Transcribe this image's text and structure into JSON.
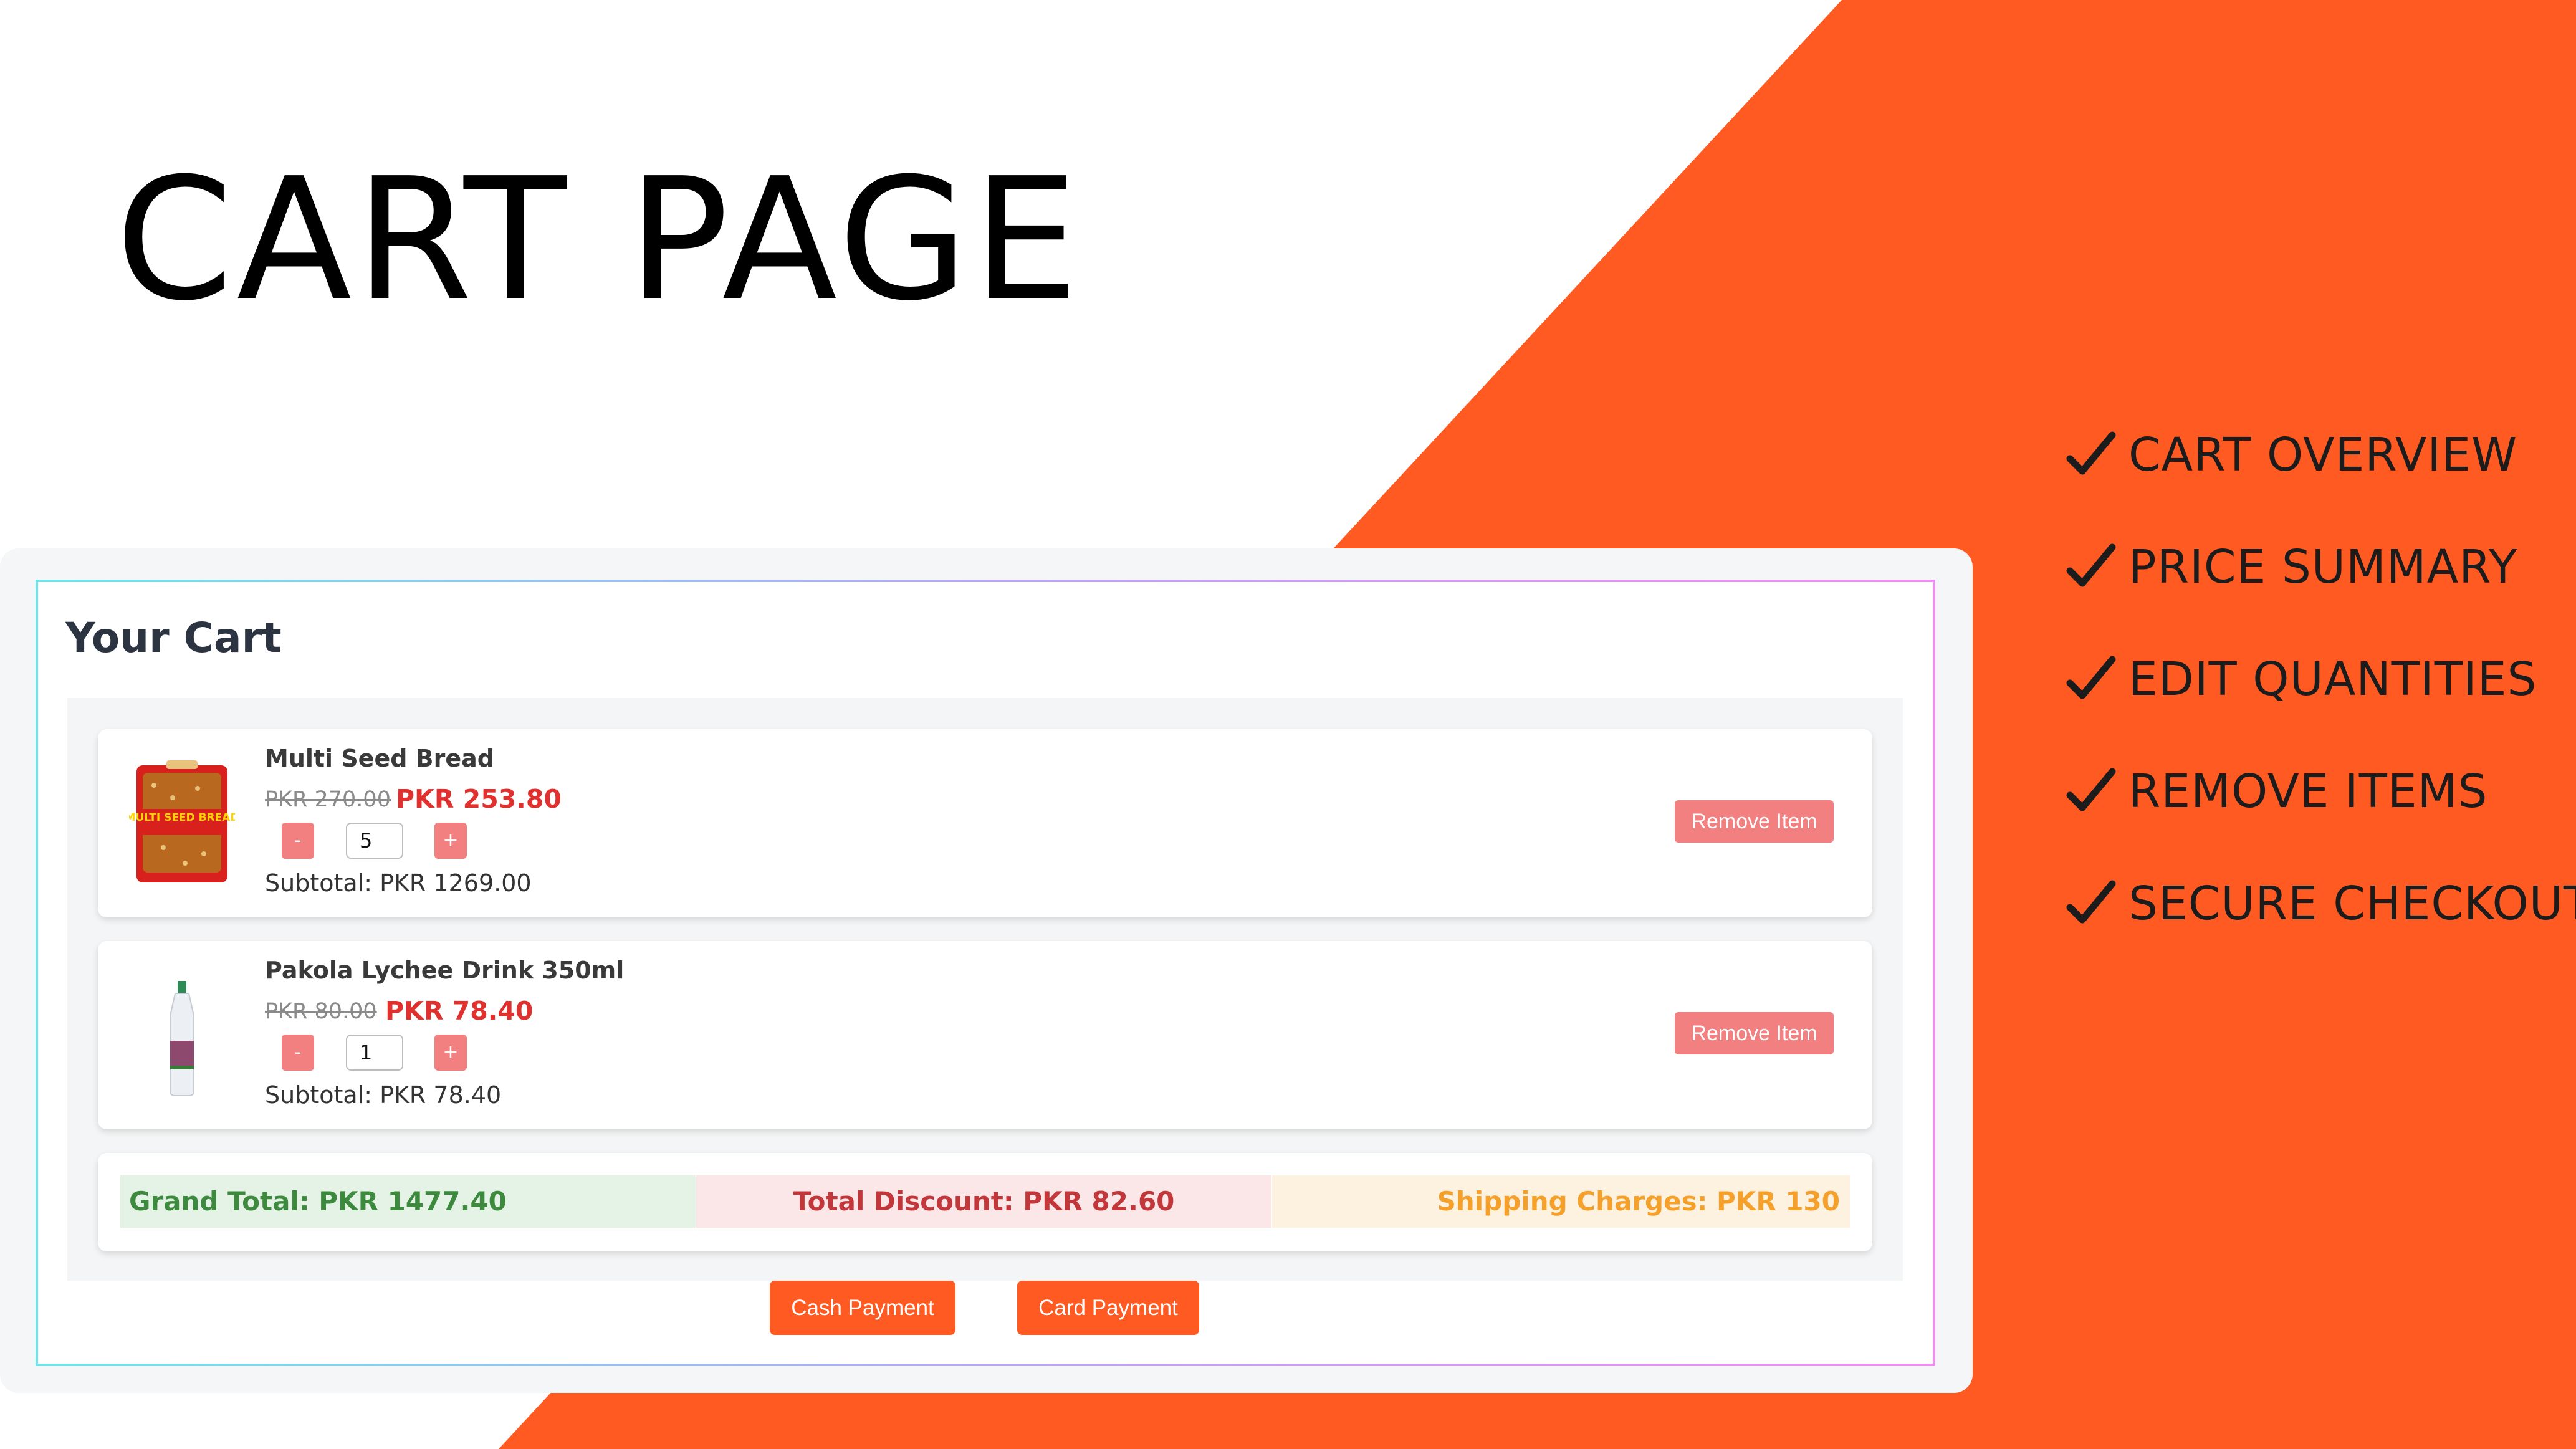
{
  "hero": {
    "title": "CART PAGE"
  },
  "features": [
    {
      "icon": "check-icon",
      "label": "CART OVERVIEW"
    },
    {
      "icon": "check-icon",
      "label": "PRICE SUMMARY"
    },
    {
      "icon": "check-icon",
      "label": "EDIT QUANTITIES"
    },
    {
      "icon": "check-icon",
      "label": "REMOVE ITEMS"
    },
    {
      "icon": "check-icon",
      "label": "SECURE CHECKOUT"
    }
  ],
  "cart": {
    "title": "Your Cart",
    "items": [
      {
        "name": "Multi Seed Bread",
        "old_price": "PKR 270.00",
        "new_price": "PKR 253.80",
        "decrement": "-",
        "quantity": "5",
        "increment": "+",
        "subtotal": "Subtotal: PKR 1269.00",
        "remove_label": "Remove Item",
        "image_text": "MULTI SEED BREAD"
      },
      {
        "name": "Pakola Lychee Drink 350ml",
        "old_price": "PKR 80.00",
        "new_price": "PKR 78.40",
        "decrement": "-",
        "quantity": "1",
        "increment": "+",
        "subtotal": "Subtotal: PKR 78.40",
        "remove_label": "Remove Item"
      }
    ],
    "totals": {
      "grand_total": "Grand Total: PKR 1477.40",
      "total_discount": "Total Discount: PKR 82.60",
      "shipping": "Shipping Charges: PKR 130"
    },
    "actions": {
      "cash": "Cash Payment",
      "card": "Card Payment"
    }
  },
  "colors": {
    "accent": "#ff5a22",
    "remove": "#f28080",
    "discount_price": "#e0312f",
    "grand_green": "#3d8a3e",
    "discount_red": "#c2373a",
    "shipping_orange": "#f4a02a"
  }
}
